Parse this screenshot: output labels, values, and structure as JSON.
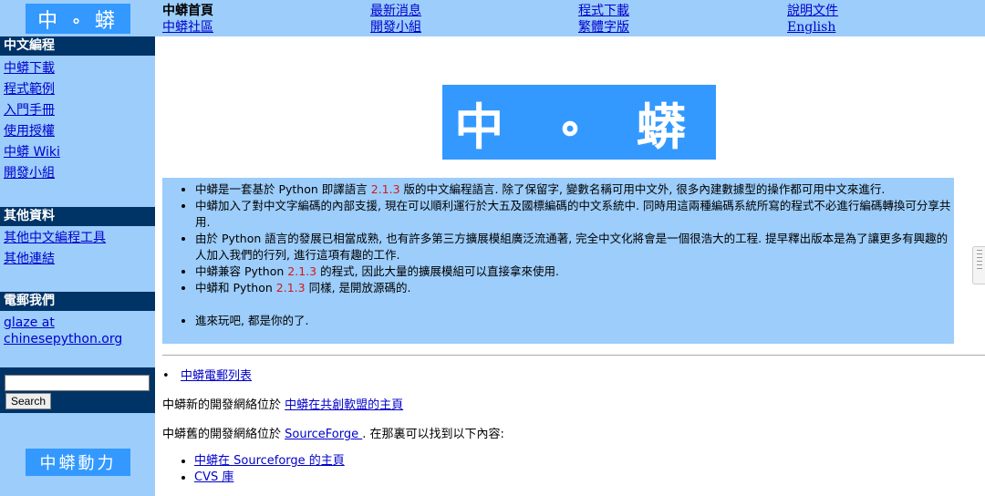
{
  "sidebar": {
    "logo": "中 ∘ 蟒",
    "sections": [
      {
        "heading": "中文編程",
        "links": [
          "中蟒下載",
          "程式範例",
          "入門手冊",
          "使用授權",
          "中蟒 Wiki",
          "開發小組"
        ]
      },
      {
        "heading": "其他資料",
        "links": [
          "其他中文編程工具",
          "其他連結"
        ]
      },
      {
        "heading": "電郵我們",
        "email": "glaze at chinesepython.org"
      }
    ],
    "search": {
      "value": "",
      "button": "Search"
    },
    "news_banner": "中蟒動力"
  },
  "topnav": {
    "items": [
      "中蟒首頁",
      "最新消息",
      "程式下載",
      "說明文件",
      "中蟒社區",
      "開發小組",
      "繁體字版",
      "English"
    ]
  },
  "main": {
    "logo": "中 ∘ 蟒",
    "intro": [
      {
        "pre": "中蟒是一套基於 Python 即譯語言 ",
        "ver": "2.1.3",
        "post": " 版的中文編程語言. 除了保留字, 變數名稱可用中文外, 很多內建數據型的操作都可用中文來進行."
      },
      {
        "pre": "中蟒加入了對中文字編碼的內部支援, 現在可以順利運行於大五及國標編碼的中文系統中. 同時用這兩種編碼系統所寫的程式不必進行編碼轉換可分享共用.",
        "ver": "",
        "post": ""
      },
      {
        "pre": "由於 Python 語言的發展已相當成熟, 也有許多第三方擴展模組廣泛流通著, 完全中文化將會是一個很浩大的工程. 提早釋出版本是為了讓更多有興趣的人加入我們的行列, 進行這項有趣的工作.",
        "ver": "",
        "post": ""
      },
      {
        "pre": "中蟒兼容 Python ",
        "ver": "2.1.3",
        "post": " 的程式, 因此大量的擴展模組可以直接拿來使用."
      },
      {
        "pre": "中蟒和 Python ",
        "ver": "2.1.3",
        "post": " 同樣, 是開放源碼的."
      },
      {
        "pre": "進來玩吧, 都是你的了.",
        "ver": "",
        "post": ""
      }
    ],
    "mail_list": "中蟒電郵列表",
    "new_site": {
      "text": "中蟒新的開發網絡位於 ",
      "link": "中蟒在共創軟盟的主頁"
    },
    "old_site": {
      "text": "中蟒舊的開發網絡位於 ",
      "link": "SourceForge ",
      "after": ". 在那裏可以找到以下內容:"
    },
    "sf_items": [
      "中蟒在 Sourceforge 的主頁",
      "CVS 庫"
    ]
  },
  "colors": {
    "sidebar_bg": "#9ccdfb",
    "heading_bg": "#003366",
    "logo_bg": "#3399ff",
    "version": "#d41a1a"
  }
}
